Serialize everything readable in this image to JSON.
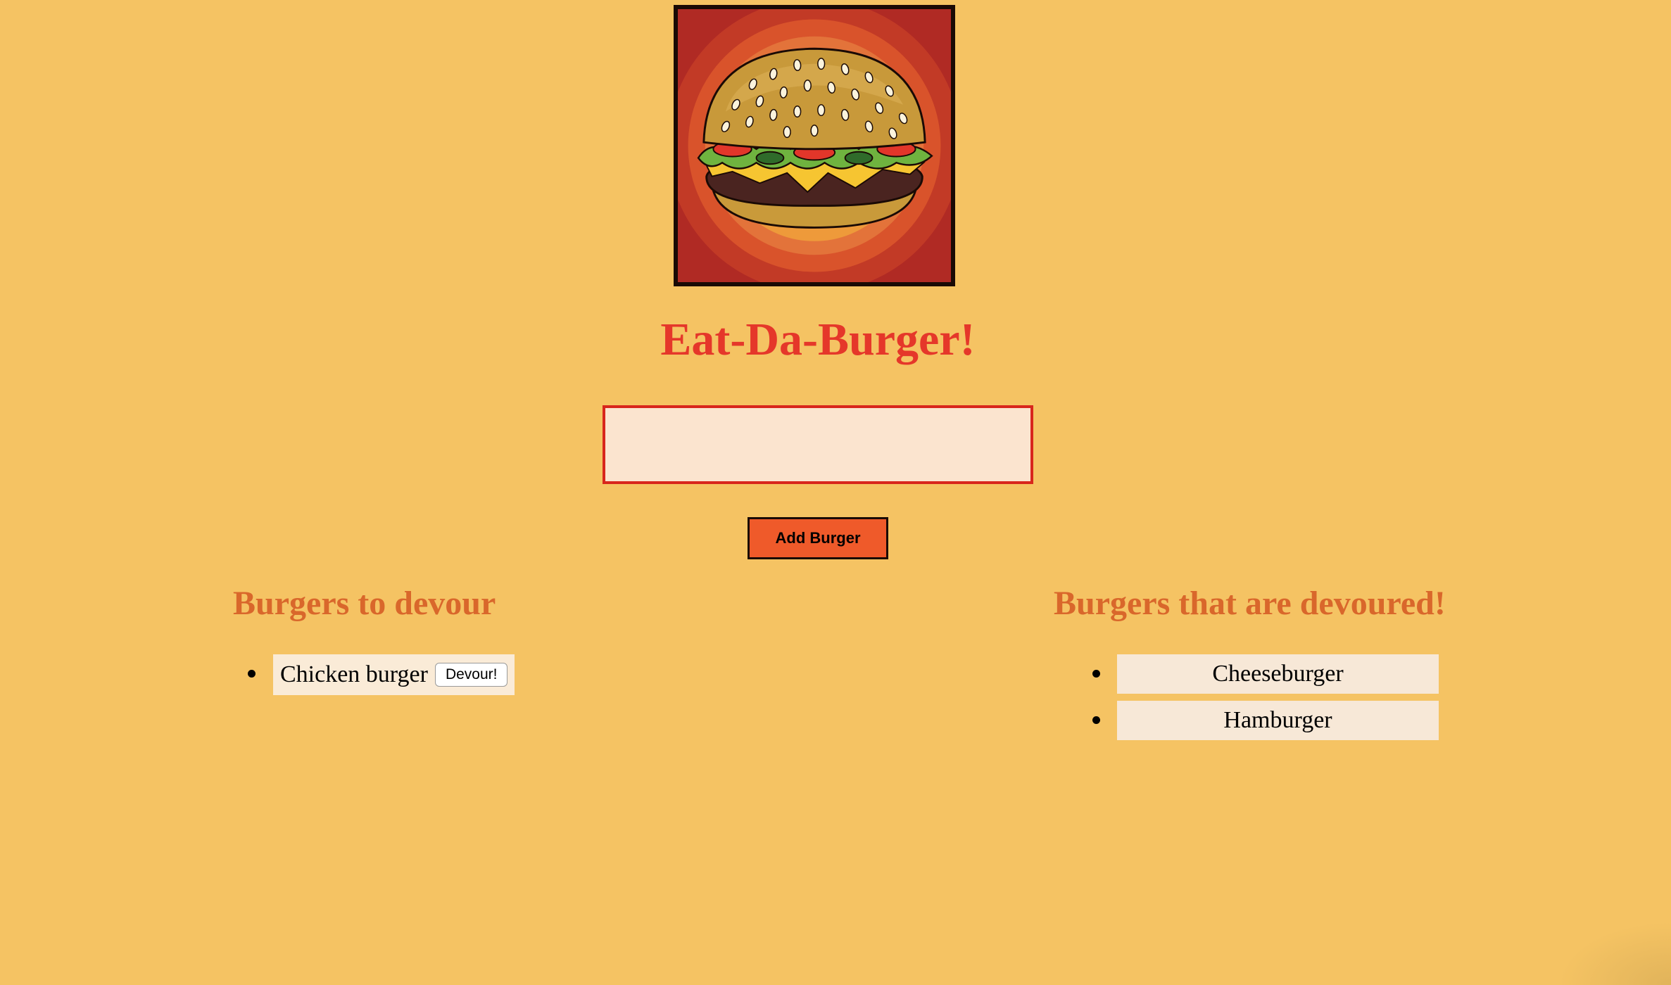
{
  "logo": {
    "icon": "burger-logo-icon",
    "colors": [
      "#b02a24",
      "#d9532b",
      "#ee9a3a",
      "#f3b340"
    ]
  },
  "header": {
    "title": "Eat-Da-Burger!"
  },
  "form": {
    "input_value": "",
    "input_placeholder": "",
    "add_button_label": "Add Burger"
  },
  "to_devour": {
    "heading": "Burgers to devour",
    "items": [
      {
        "name": "Chicken burger",
        "button_label": "Devour!"
      }
    ]
  },
  "devoured": {
    "heading": "Burgers that are devoured!",
    "items": [
      {
        "name": "Cheeseburger"
      },
      {
        "name": "Hamburger"
      }
    ]
  },
  "colors": {
    "background": "#f5c363",
    "title": "#e5372a",
    "headings": "#d9672b",
    "button": "#ef5a2a",
    "input_border": "#d8261c"
  }
}
